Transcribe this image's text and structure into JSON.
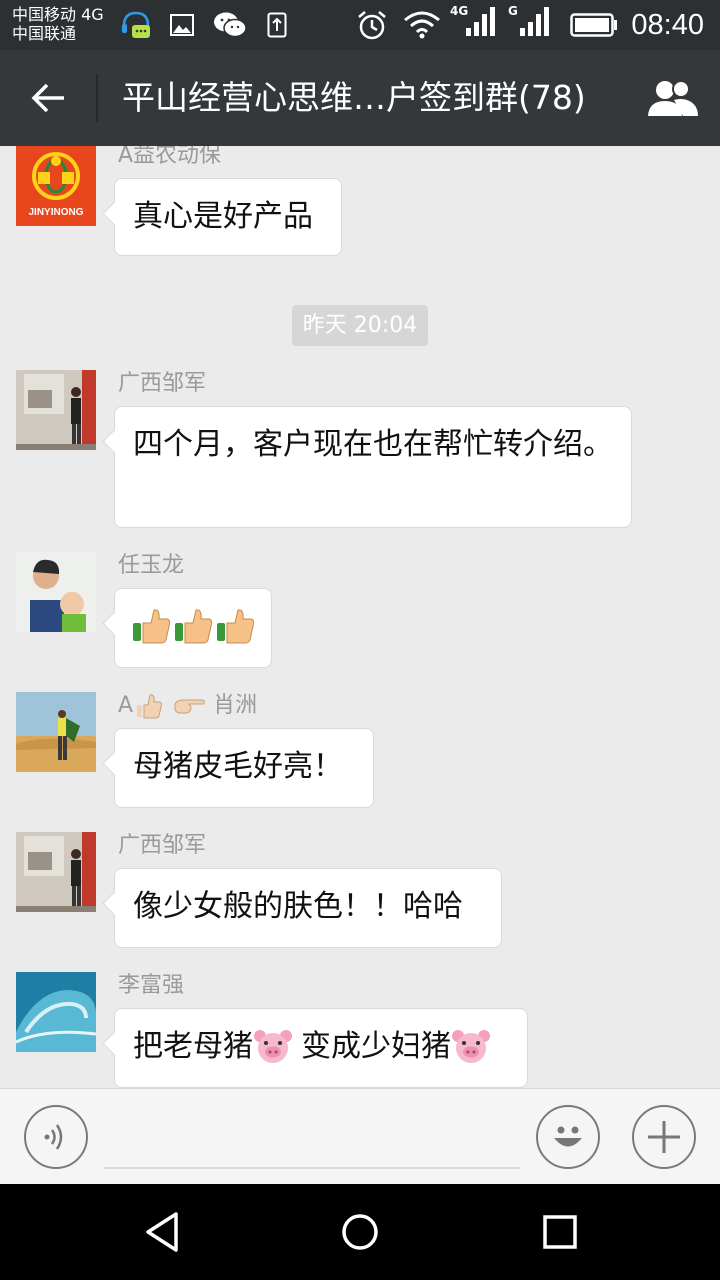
{
  "status_bar": {
    "carrier_1": "中国移动 4G",
    "carrier_2": "中国联通",
    "net_label_1": "4G",
    "net_label_2": "G",
    "time": "08:40"
  },
  "header": {
    "title": "平山经营心思维…户签到群(78)"
  },
  "chat": {
    "timestamp": "昨天 20:04",
    "messages": [
      {
        "sender": "A益农动保",
        "text": "真心是好产品",
        "avatar_text": "JINYINONG",
        "avatar_icon": "jinyinong-logo-icon"
      },
      {
        "sender": "广西邹军",
        "text": "四个月，客户现在也在帮忙转介绍。"
      },
      {
        "sender": "任玉龙",
        "text": "",
        "emoji": "thumbs-up-icon",
        "emoji_count": 3
      },
      {
        "sender_prefix": "A",
        "sender_name": "肖洲",
        "sender_emoji": [
          "thumbs-up-icon",
          "pointing-right-icon"
        ],
        "text": "母猪皮毛好亮！"
      },
      {
        "sender": "广西邹军",
        "text": "像少女般的肤色！！哈哈"
      },
      {
        "sender": "李富强",
        "text_1": "把老母猪",
        "text_2": "变成少妇猪",
        "emoji": "pig-face-icon"
      }
    ]
  },
  "colors": {
    "status_bar_bg": "#2d3033",
    "title_bar_bg": "#34383b",
    "chat_bg": "#ebebeb",
    "bubble_bg": "#ffffff",
    "time_pill_bg": "#d6d6d6",
    "nav_bar_bg": "#000000"
  }
}
